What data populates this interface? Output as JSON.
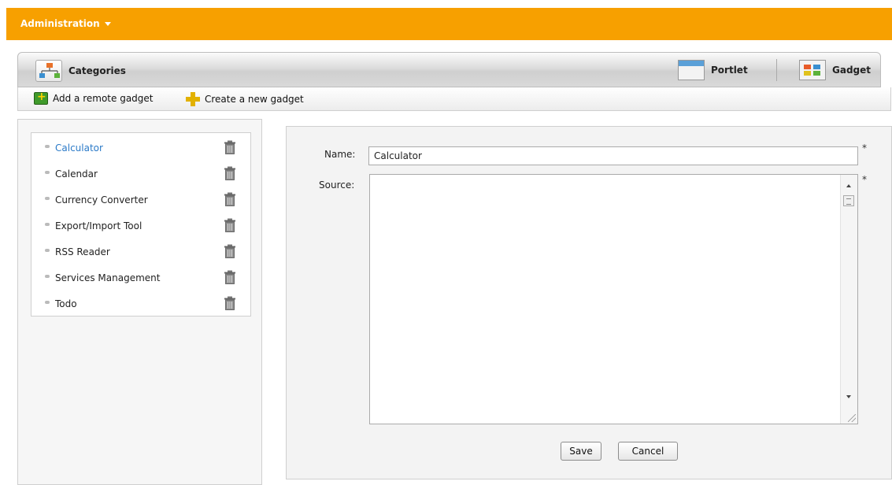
{
  "topbar": {
    "menu_label": "Administration"
  },
  "toolbar": {
    "categories_label": "Categories",
    "portlet_label": "Portlet",
    "gadget_label": "Gadget"
  },
  "actions": {
    "add_remote": "Add a remote gadget",
    "create_new": "Create a new gadget"
  },
  "gadgets": {
    "items": [
      {
        "label": "Calculator",
        "active": true
      },
      {
        "label": "Calendar"
      },
      {
        "label": "Currency Converter"
      },
      {
        "label": "Export/Import Tool"
      },
      {
        "label": "RSS Reader"
      },
      {
        "label": "Services Management"
      },
      {
        "label": "Todo"
      }
    ]
  },
  "form": {
    "name_label": "Name:",
    "name_value": "Calculator",
    "source_label": "Source:",
    "required_mark": "*",
    "save_label": "Save",
    "cancel_label": "Cancel"
  },
  "colors": {
    "topbar": "#f7a000",
    "active_link": "#2b7ac8"
  }
}
